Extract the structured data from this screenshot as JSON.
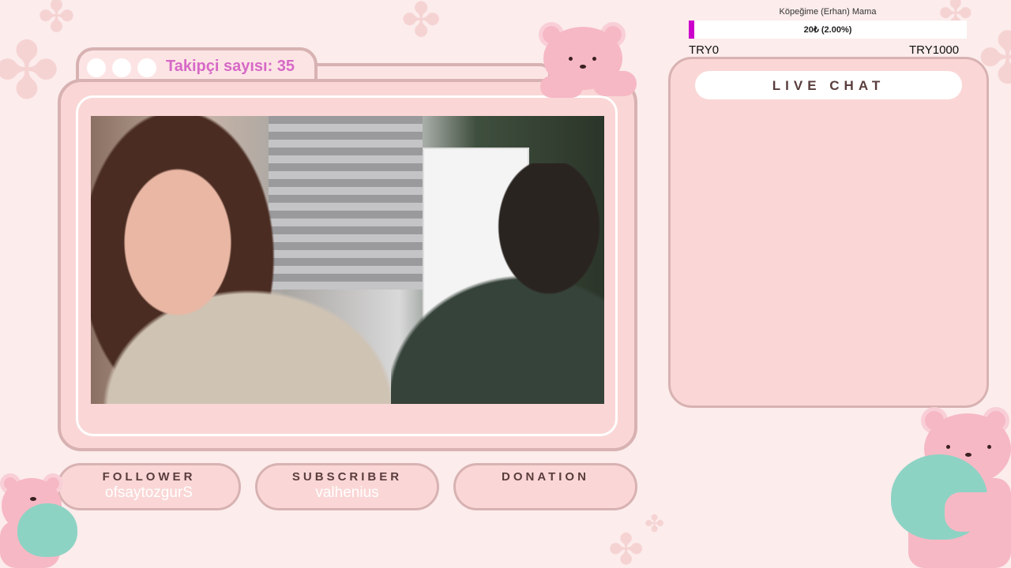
{
  "window": {
    "follower_count_label": "Takipçi sayısı: 35"
  },
  "video": {
    "description_icon": "webcam-feed"
  },
  "bottom_panels": [
    {
      "label": "FOLLOWER",
      "value": "ofsaytozgurS"
    },
    {
      "label": "SUBSCRIBER",
      "value": "valhenius"
    },
    {
      "label": "DONATION",
      "value": ""
    }
  ],
  "donation_goal": {
    "title": "Köpeğime (Erhan) Mama",
    "progress_text": "20₺ (2.00%)",
    "progress_fraction": 0.02,
    "min_label": "TRY0",
    "max_label": "TRY1000",
    "fill_color": "#cc00cc"
  },
  "chat": {
    "header": "LIVE CHAT"
  },
  "colors": {
    "background": "#fcecec",
    "panel": "#fad7d6",
    "border": "#d8b2b2",
    "title_accent": "#d669c7",
    "bear": "#f6b8c4",
    "heart": "#8dd3c4"
  },
  "icons": [
    "clover-icon",
    "bear-icon",
    "heart-icon",
    "window-dot-icon"
  ]
}
